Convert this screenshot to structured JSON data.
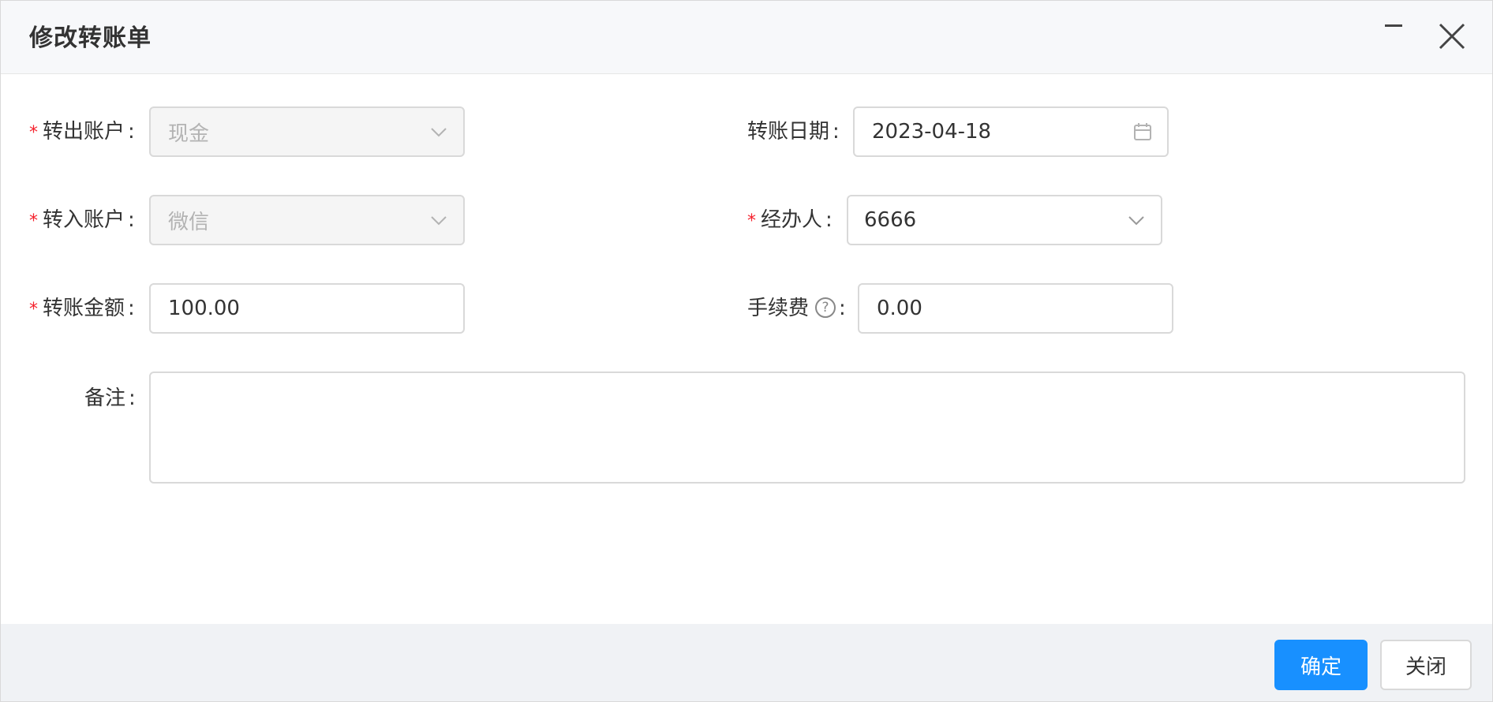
{
  "dialog": {
    "title": "修改转账单",
    "minimize_icon": "minimize-icon",
    "close_icon": "close-icon"
  },
  "form": {
    "from_account": {
      "label": "转出账户",
      "required": true,
      "value": "现金",
      "disabled": true,
      "icon": "chevron-down-icon"
    },
    "to_account": {
      "label": "转入账户",
      "required": true,
      "value": "微信",
      "disabled": true,
      "icon": "chevron-down-icon"
    },
    "amount": {
      "label": "转账金额",
      "required": true,
      "value": "100.00"
    },
    "date": {
      "label": "转账日期",
      "required": false,
      "value": "2023-04-18",
      "icon": "calendar-icon"
    },
    "handler": {
      "label": "经办人",
      "required": true,
      "value": "6666",
      "icon": "chevron-down-icon"
    },
    "fee": {
      "label": "手续费",
      "required": false,
      "value": "0.00",
      "help_icon": "question-circle-icon"
    },
    "remark": {
      "label": "备注",
      "value": ""
    },
    "required_mark": "*",
    "colon": ":"
  },
  "footer": {
    "confirm_label": "确定",
    "close_label": "关闭"
  },
  "colors": {
    "primary": "#1890ff",
    "required": "#f5222d",
    "header_bg": "#f7f8fa",
    "footer_bg": "#f0f2f5"
  }
}
